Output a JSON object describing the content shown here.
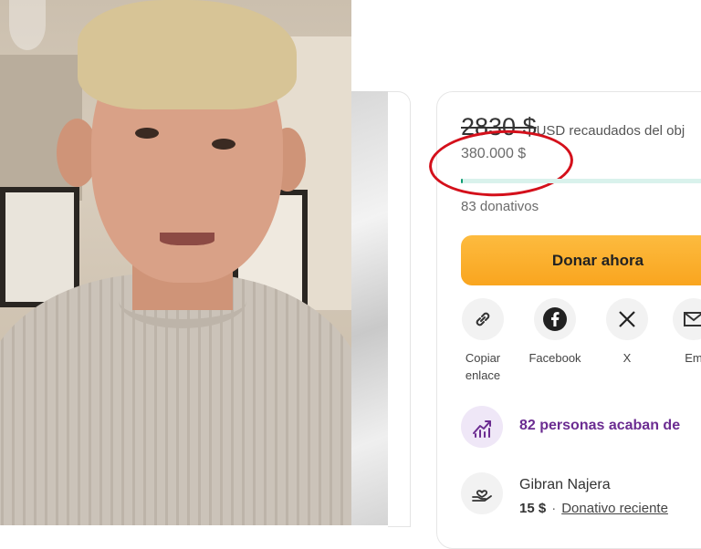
{
  "campaign": {
    "raised_amount": "2830 $",
    "raised_suffix": "USD recaudados del obj",
    "goal": "380.000 $",
    "progress_fraction": 0.0075,
    "donation_count": "83 donativos",
    "donate_button": "Donar ahora",
    "share": [
      {
        "icon": "link-icon",
        "label": "Copiar enlace"
      },
      {
        "icon": "facebook-icon",
        "label": "Facebook"
      },
      {
        "icon": "x-icon",
        "label": "X"
      },
      {
        "icon": "email-icon",
        "label": "Em"
      }
    ],
    "trending_text": "82 personas acaban de",
    "recent_donor": {
      "name": "Gibran Najera",
      "amount": "15 $",
      "separator": "·",
      "tag": "Donativo reciente"
    }
  },
  "colors": {
    "accent_purple": "#6b2c91",
    "donate_orange": "#f9a51f",
    "progress_green": "#0f9d72",
    "annotation_red": "#d4101b"
  }
}
